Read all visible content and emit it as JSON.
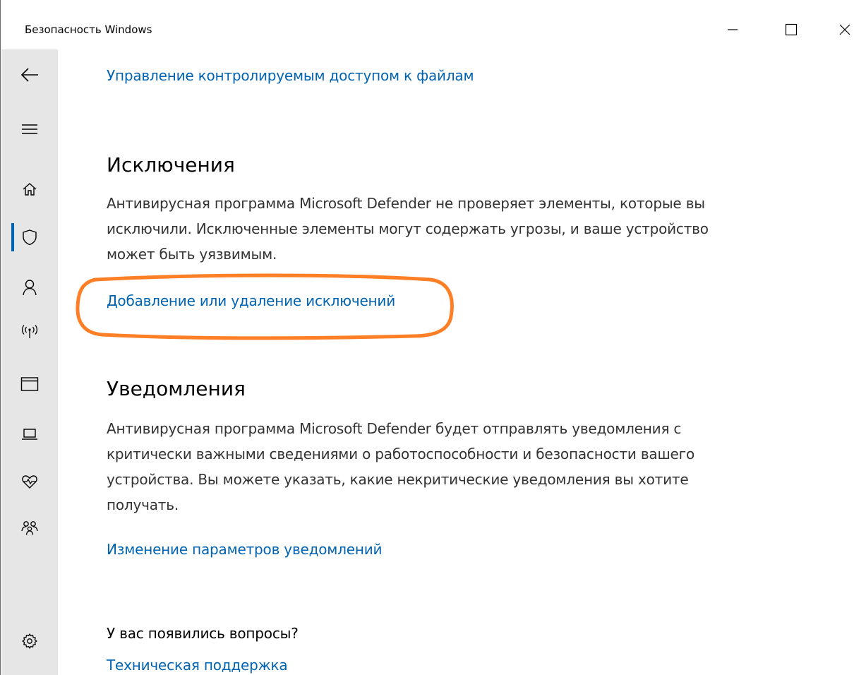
{
  "window": {
    "title": "Безопасность Windows",
    "controls": {
      "minimize": "minimize-icon",
      "maximize": "maximize-icon",
      "close": "close-icon"
    }
  },
  "sidebar": {
    "items": [
      {
        "name": "back",
        "icon": "back-arrow-icon"
      },
      {
        "name": "menu",
        "icon": "hamburger-icon"
      },
      {
        "name": "home",
        "icon": "home-icon"
      },
      {
        "name": "virus-protection",
        "icon": "shield-icon",
        "selected": true
      },
      {
        "name": "account",
        "icon": "person-icon"
      },
      {
        "name": "firewall",
        "icon": "wireless-icon"
      },
      {
        "name": "app-browser",
        "icon": "window-icon"
      },
      {
        "name": "device-security",
        "icon": "laptop-icon"
      },
      {
        "name": "device-health",
        "icon": "heart-icon"
      },
      {
        "name": "family",
        "icon": "family-icon"
      },
      {
        "name": "settings",
        "icon": "gear-icon"
      }
    ],
    "accent": "#0063b1"
  },
  "main": {
    "controlled_access_link": "Управление контролируемым доступом к файлам",
    "exclusions": {
      "heading": "Исключения",
      "text": "Антивирусная программа Microsoft Defender не проверяет элементы, которые вы исключили. Исключенные элементы могут содержать угрозы, и ваше устройство может быть уязвимым.",
      "link": "Добавление или удаление исключений"
    },
    "notifications": {
      "heading": "Уведомления",
      "text": "Антивирусная программа Microsoft Defender будет отправлять уведомления с критически важными сведениями о работоспособности и безопасности вашего устройства. Вы можете указать, какие некритические уведомления вы хотите получать.",
      "link": "Изменение параметров уведомлений"
    },
    "help": {
      "question": "У вас появились вопросы?",
      "link": "Техническая поддержка"
    }
  },
  "colors": {
    "link": "#0063b1",
    "highlight": "#ff7f27",
    "sidebar_bg": "#e6e6e6"
  }
}
